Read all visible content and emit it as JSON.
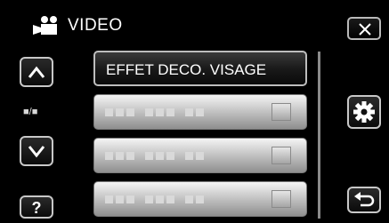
{
  "header": {
    "title": "VIDEO",
    "mode_icon": "video-camera-icon",
    "close_icon": "close-icon"
  },
  "left_controls": {
    "up_icon": "chevron-up-icon",
    "page_indicator": "■/■",
    "down_icon": "chevron-down-icon",
    "help_label": "?"
  },
  "right_controls": {
    "settings_icon": "gear-icon",
    "back_icon": "return-arrow-icon"
  },
  "menu": {
    "items": [
      {
        "label": "EFFET DECO. VISAGE",
        "state": "selected"
      },
      {
        "label": "",
        "state": "placeholder"
      },
      {
        "label": "",
        "state": "placeholder"
      },
      {
        "label": "",
        "state": "placeholder"
      }
    ]
  },
  "colors": {
    "background": "#000000",
    "selected_item": "#1a1a1a",
    "unselected_item": "#c8c8c8",
    "border": "#c8c8c8"
  }
}
